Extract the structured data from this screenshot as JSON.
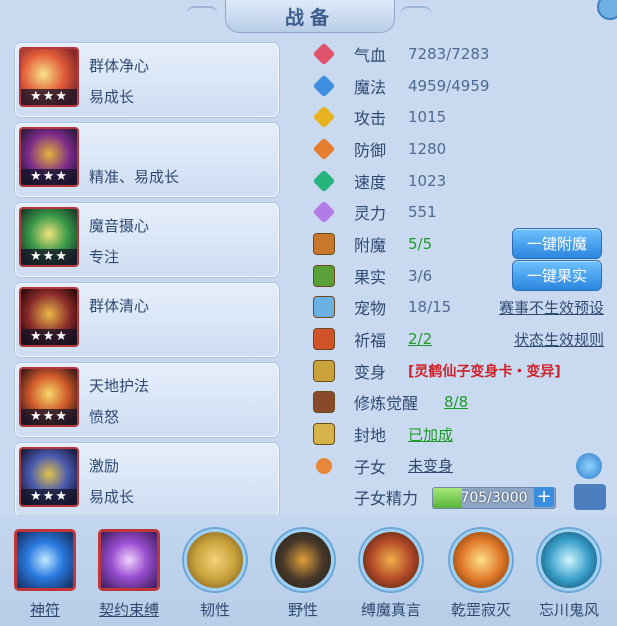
{
  "title": "战备",
  "skills": [
    {
      "line1": "群体净心",
      "line2": "易成长",
      "stars": "★★★",
      "icon": "potion-icon",
      "color": "#c9493a"
    },
    {
      "line1": "",
      "line2": "精准、易成长",
      "stars": "★★★",
      "icon": "demon-warrior-icon",
      "color": "#5a2a6e"
    },
    {
      "line1": "魔音摄心",
      "line2": "专注",
      "stars": "★★★",
      "icon": "eye-sigil-icon",
      "color": "#3a7a3a"
    },
    {
      "line1": "群体清心",
      "line2": "",
      "stars": "★★★",
      "icon": "snake-icon",
      "color": "#6a2a2a"
    },
    {
      "line1": "天地护法",
      "line2": "愤怒",
      "stars": "★★★",
      "icon": "golden-ring-icon",
      "color": "#8a3a1a"
    },
    {
      "line1": "激励",
      "line2": "易成长",
      "stars": "★★★",
      "icon": "warrior-shadow-icon",
      "color": "#3a4a8a"
    }
  ],
  "stats": [
    {
      "label": "气血",
      "value": "7283/7283",
      "icon": "heart-icon",
      "color": "#e0536b"
    },
    {
      "label": "魔法",
      "value": "4959/4959",
      "icon": "mana-icon",
      "color": "#3f8fe0"
    },
    {
      "label": "攻击",
      "value": "1015",
      "icon": "sword-icon",
      "color": "#e7b21f"
    },
    {
      "label": "防御",
      "value": "1280",
      "icon": "shield-icon",
      "color": "#e57f2f"
    },
    {
      "label": "速度",
      "value": "1023",
      "icon": "speed-icon",
      "color": "#26b37c"
    },
    {
      "label": "灵力",
      "value": "551",
      "icon": "spirit-icon",
      "color": "#b17be6"
    }
  ],
  "attrs": {
    "fumo": {
      "label": "附魔",
      "value": "5/5",
      "button": "一键附魔"
    },
    "guoshi": {
      "label": "果实",
      "value": "3/6",
      "button": "一键果实"
    },
    "chongwu": {
      "label": "宠物",
      "value": "18/15",
      "link": "赛事不生效预设"
    },
    "qifu": {
      "label": "祈福",
      "value": "2/2",
      "link": "状态生效规则"
    },
    "bianshen": {
      "label": "变身",
      "value": "[灵鹤仙子变身卡・变异]"
    },
    "xiulian": {
      "label": "修炼觉醒",
      "value": "8/8"
    },
    "fengdi": {
      "label": "封地",
      "value": "已加成"
    },
    "zinv": {
      "label": "子女",
      "value": "未变身"
    },
    "jingli": {
      "label": "子女精力",
      "value": "705/3000",
      "fraction": 0.235
    }
  },
  "bottom": [
    {
      "name": "神符",
      "style": "square",
      "underline": true,
      "color": "#3a8fe0",
      "icon": "rune-orb-icon"
    },
    {
      "name": "契约束缚",
      "style": "square",
      "underline": true,
      "color": "#9a4fd0",
      "icon": "contract-icon"
    },
    {
      "name": "韧性",
      "style": "round",
      "underline": false,
      "color": "#c9a23a",
      "icon": "golden-body-icon"
    },
    {
      "name": "野性",
      "style": "round",
      "underline": false,
      "color": "#4a3a2a",
      "icon": "beast-icon"
    },
    {
      "name": "缚魔真言",
      "style": "round",
      "underline": false,
      "color": "#b24a2a",
      "icon": "chain-icon"
    },
    {
      "name": "乾罡寂灭",
      "style": "round",
      "underline": false,
      "color": "#e07a2a",
      "icon": "fire-fist-icon"
    },
    {
      "name": "忘川鬼风",
      "style": "round",
      "underline": false,
      "color": "#3aa0c9",
      "icon": "wind-icon"
    }
  ]
}
